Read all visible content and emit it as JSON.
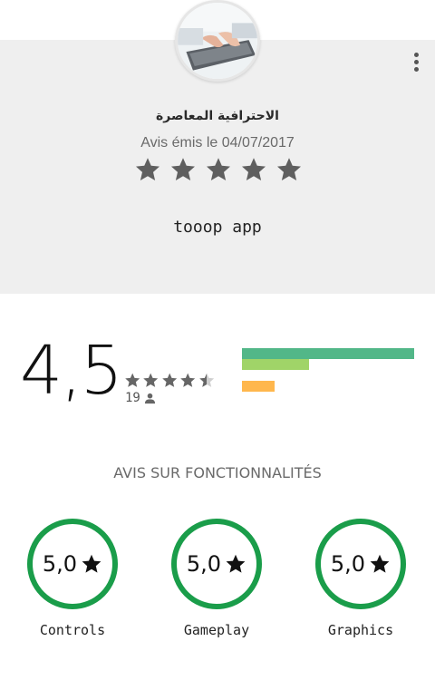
{
  "review": {
    "reviewer_name": "الاحترافية المعاصرة",
    "date": "Avis émis le 04/07/2017",
    "stars": 5,
    "text": "tooop app",
    "star_color": "#5f5f5f"
  },
  "summary": {
    "average": "4,5",
    "average_stars": 4.5,
    "rating_count": "19",
    "distribution": [
      {
        "fraction": 1.0,
        "color": "#52b788"
      },
      {
        "fraction": 0.39,
        "color": "#a0d468"
      },
      {
        "fraction": 0.0,
        "color": "#ffd64d"
      },
      {
        "fraction": 0.19,
        "color": "#ffb74d"
      },
      {
        "fraction": 0.0,
        "color": "#e57373"
      }
    ]
  },
  "features": {
    "title": "AVIS SUR FONCTIONNALITÉS",
    "items": [
      {
        "score": "5,0",
        "label": "Controls"
      },
      {
        "score": "5,0",
        "label": "Gameplay"
      },
      {
        "score": "5,0",
        "label": "Graphics"
      }
    ],
    "ring_color": "#1a9d4a"
  },
  "icons": {
    "avatar": "laptop-typing-photo",
    "menu": "more-vertical-icon",
    "star": "star-icon",
    "person": "person-icon"
  }
}
